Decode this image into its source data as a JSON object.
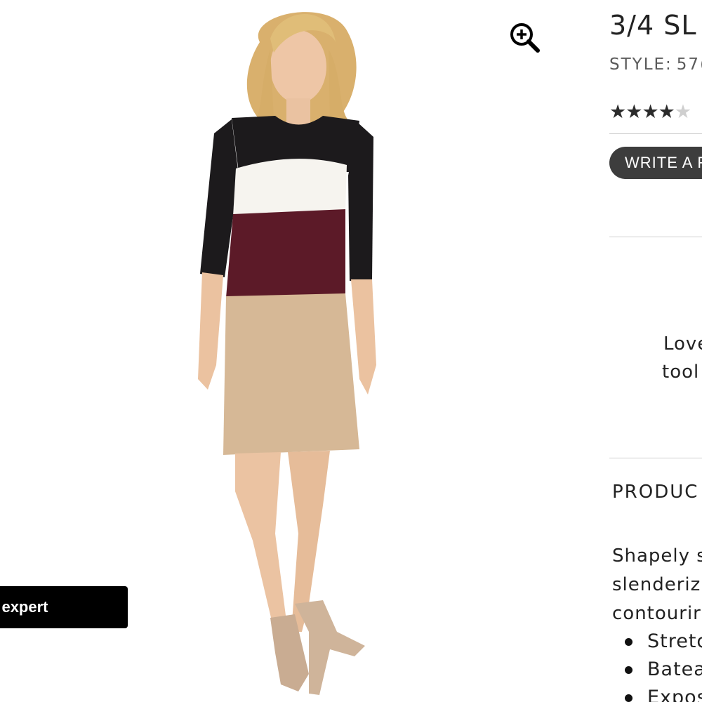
{
  "product": {
    "title": "3/4 SL",
    "style_label": "STYLE:",
    "style_number": "57(",
    "rating": 4,
    "rating_max": 5
  },
  "actions": {
    "zoom_icon": "zoom-in-icon",
    "chat_label": "le expert",
    "write_review_label": "WRITE A F"
  },
  "promo": {
    "line1": "Love",
    "line2": "tool"
  },
  "details": {
    "heading": "PRODUC",
    "description": [
      "Shapely s",
      "slenderiz",
      "contourir"
    ],
    "features": [
      "Stretc",
      "Batea",
      "Expos"
    ]
  },
  "colors": {
    "dress_top": "#1c1a1c",
    "dress_white": "#f6f4ef",
    "dress_burgundy": "#5c1a28",
    "dress_tan": "#d6b896",
    "button_bg": "#3d3d3d",
    "chat_bg": "#000000"
  }
}
